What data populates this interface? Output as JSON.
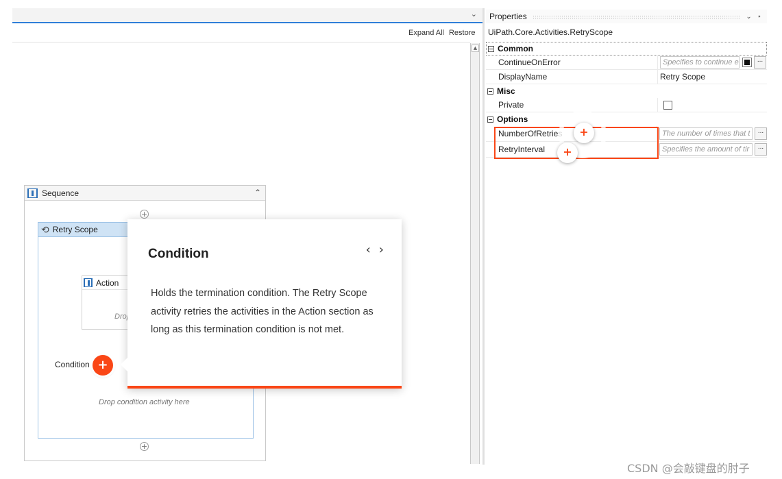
{
  "designer": {
    "expand_all": "Expand All",
    "restore": "Restore",
    "sequence_title": "Sequence",
    "retry_scope_title": "Retry Scope",
    "action_title": "Action",
    "action_drop_text": "Drop",
    "condition_label": "Condition",
    "condition_drop_text": "Drop condition activity here"
  },
  "tooltip": {
    "title": "Condition",
    "body": "Holds the termination condition. The Retry Scope activity retries the activities in the Action section as long as this termination condition is not met.",
    "prev": "‹",
    "next": "›"
  },
  "properties": {
    "title": "Properties",
    "activity_type": "UiPath.Core.Activities.RetryScope",
    "categories": {
      "common": "Common",
      "misc": "Misc",
      "options": "Options"
    },
    "rows": {
      "continue_on_error": {
        "name": "ContinueOnError",
        "placeholder": "Specifies to continue e"
      },
      "display_name": {
        "name": "DisplayName",
        "value": "Retry Scope"
      },
      "private": {
        "name": "Private"
      },
      "number_of_retries": {
        "name": "NumberOfRetries",
        "placeholder": "The number of times that t"
      },
      "retry_interval": {
        "name": "RetryInterval",
        "placeholder": "Specifies the amount of tir"
      }
    },
    "ellipsis": "..."
  },
  "watermark": "CSDN @会敲键盘的肘子",
  "colors": {
    "accent_orange": "#fa4616",
    "selection_blue": "#cfe3f5",
    "designer_accent": "#2f7ed8"
  }
}
